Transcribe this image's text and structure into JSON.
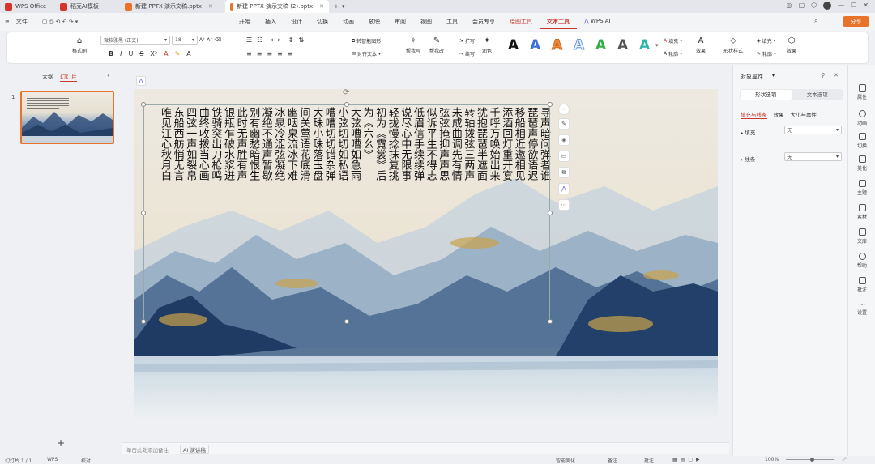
{
  "titlebar": {
    "tabs": [
      {
        "label": "WPS Office",
        "color": "#d6352b"
      },
      {
        "label": "稻壳AI模板",
        "color": "#d6352b"
      },
      {
        "label": "新建 PPTX 演示文稿.pptx",
        "color": "#e8742c"
      },
      {
        "label": "新建 PPTX 演示文稿 (2).pptx",
        "color": "#e8742c"
      }
    ],
    "new_tab": "+"
  },
  "menubar": {
    "file": "文件",
    "items": [
      "开始",
      "插入",
      "设计",
      "切换",
      "动画",
      "放映",
      "审阅",
      "视图",
      "工具",
      "会员专享",
      "绘图工具",
      "文本工具",
      "WPS AI"
    ],
    "share": "分享"
  },
  "ribbon": {
    "format_painter": "格式刷",
    "font_name": "微软雅黑 (正文)",
    "font_size": "18",
    "smart_shape": "转智能图形",
    "align_text": "对齐文本",
    "help_write": "帮我写",
    "help_edit": "帮我改",
    "expand": "扩写",
    "continue_write": "续写",
    "polish": "润色",
    "fill": "填充",
    "outline": "轮廓",
    "effects": "效果",
    "shape_style": "形状样式",
    "fill2": "填充",
    "outline2": "轮廓",
    "effects2": "效果",
    "text_styles": [
      "A",
      "A",
      "A",
      "A",
      "A",
      "A",
      "A"
    ]
  },
  "leftpanel": {
    "tab_outline": "大纲",
    "tab_slides": "幻灯片",
    "slide_number": "1",
    "add": "+"
  },
  "slide": {
    "poem_columns": [
      "寻声暗问弹者谁",
      "琵琶声停欲语迟",
      "移船相近邀相见",
      "添酒回灯重开宴",
      "千呼万唤始出来",
      "犹抱琵琶半遮面",
      "转轴拨弦三两声",
      "未成曲调先有情",
      "弦弦掩抑声声思",
      "似诉平生不得志",
      "低眉信手续续弹",
      "说尽心中无限事",
      "轻拢慢捻抹复挑",
      "初为《霓裳》后",
      "为《六幺》",
      "大弦嘈嘈如急雨",
      "小弦切切如私语",
      "嘈嘈切切错杂弹",
      "大珠小珠落玉盘",
      "间关莺语花底滑",
      "幽咽泉流冰下难",
      "冰泉冷涩弦凝绝",
      "凝绝不通声暂歇",
      "别有幽愁暗恨生",
      "此时无声胜有声",
      "银瓶乍破水浆迸",
      "铁骑突出刀枪鸣",
      "曲终收拨当心画",
      "四弦一声如裂帛",
      "东船西舫悄无言",
      "唯见江心秋月白"
    ]
  },
  "rightpanel": {
    "title": "对象属性",
    "tab_shape": "形状选项",
    "tab_text": "文本选项",
    "sub_fill_line": "填充与线条",
    "sub_effects": "效果",
    "sub_size": "大小与属性",
    "fill_label": "填充",
    "fill_value": "无",
    "line_label": "线条",
    "line_value": "无"
  },
  "rightbar": {
    "items": [
      "属性",
      "动画",
      "切换",
      "美化",
      "主题",
      "素材",
      "文库",
      "帮助",
      "批注",
      "设置"
    ]
  },
  "statusbar": {
    "slide_info": "幻灯片 1 / 1",
    "app": "WPS",
    "proofread": "校对",
    "notes_hint": "单击此处添加备注",
    "ai_notes": "AI 演讲稿",
    "smart_beautify": "智能美化",
    "notes": "备注",
    "comment": "批注",
    "zoom": "100%"
  },
  "colors": {
    "accent": "#c8382d",
    "share_bg": "#e8742c"
  }
}
